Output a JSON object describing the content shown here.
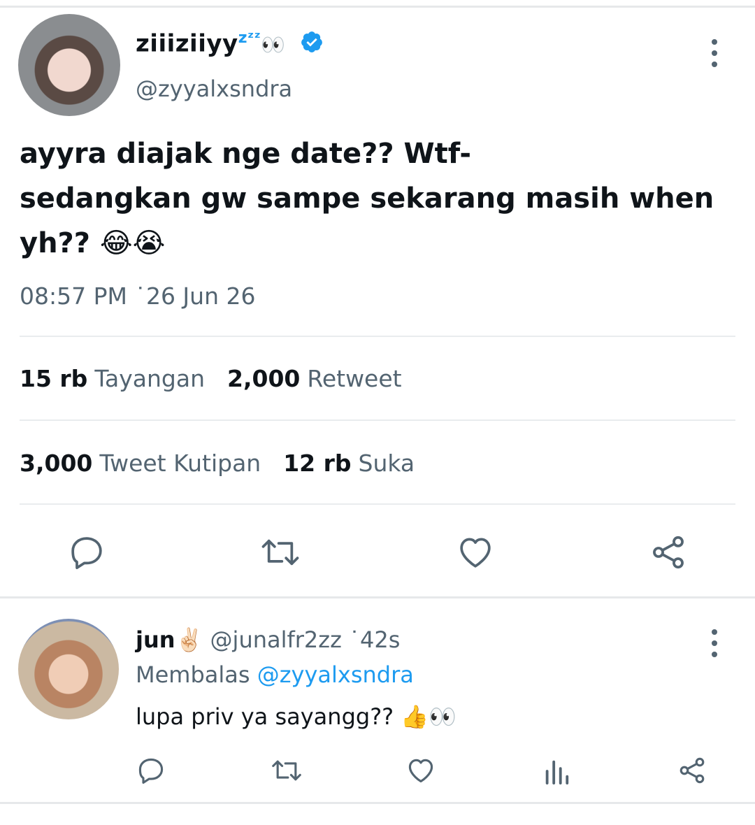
{
  "tweet": {
    "display_name": "ziiiziiyy",
    "name_suffix": "zᶻᶻ",
    "name_emoji": "👀",
    "handle": "@zyyalxsndra",
    "text": "ayyra diajak nge date?? Wtf-\nsedangkan gw sampe sekarang masih when\nyh?? 😂😭",
    "timestamp": "08:57 PM ˙26 Jun 26",
    "stats": {
      "views_count": "15 rb",
      "views_label": "Tayangan",
      "retweets_count": "2,000",
      "retweets_label": "Retweet",
      "quotes_count": "3,000",
      "quotes_label": "Tweet Kutipan",
      "likes_count": "12 rb",
      "likes_label": "Suka"
    },
    "icons": [
      "reply-icon",
      "retweet-icon",
      "like-icon",
      "share-icon",
      "verified-badge-icon",
      "more-options-icon"
    ]
  },
  "reply": {
    "display_name": "jun✌🏻",
    "handle": "@junalfr2zz",
    "time": "˙42s",
    "replying_prefix": "Membalas",
    "replying_to": "@zyyalxsndra",
    "text": "lupa priv ya sayangg?? 👍👀",
    "icons": [
      "reply-icon",
      "retweet-icon",
      "like-icon",
      "analytics-icon",
      "share-icon",
      "more-options-icon"
    ]
  },
  "colors": {
    "text": "#0f1419",
    "secondary": "#536471",
    "accent": "#1d9bf0",
    "divider": "#e9ecee"
  }
}
